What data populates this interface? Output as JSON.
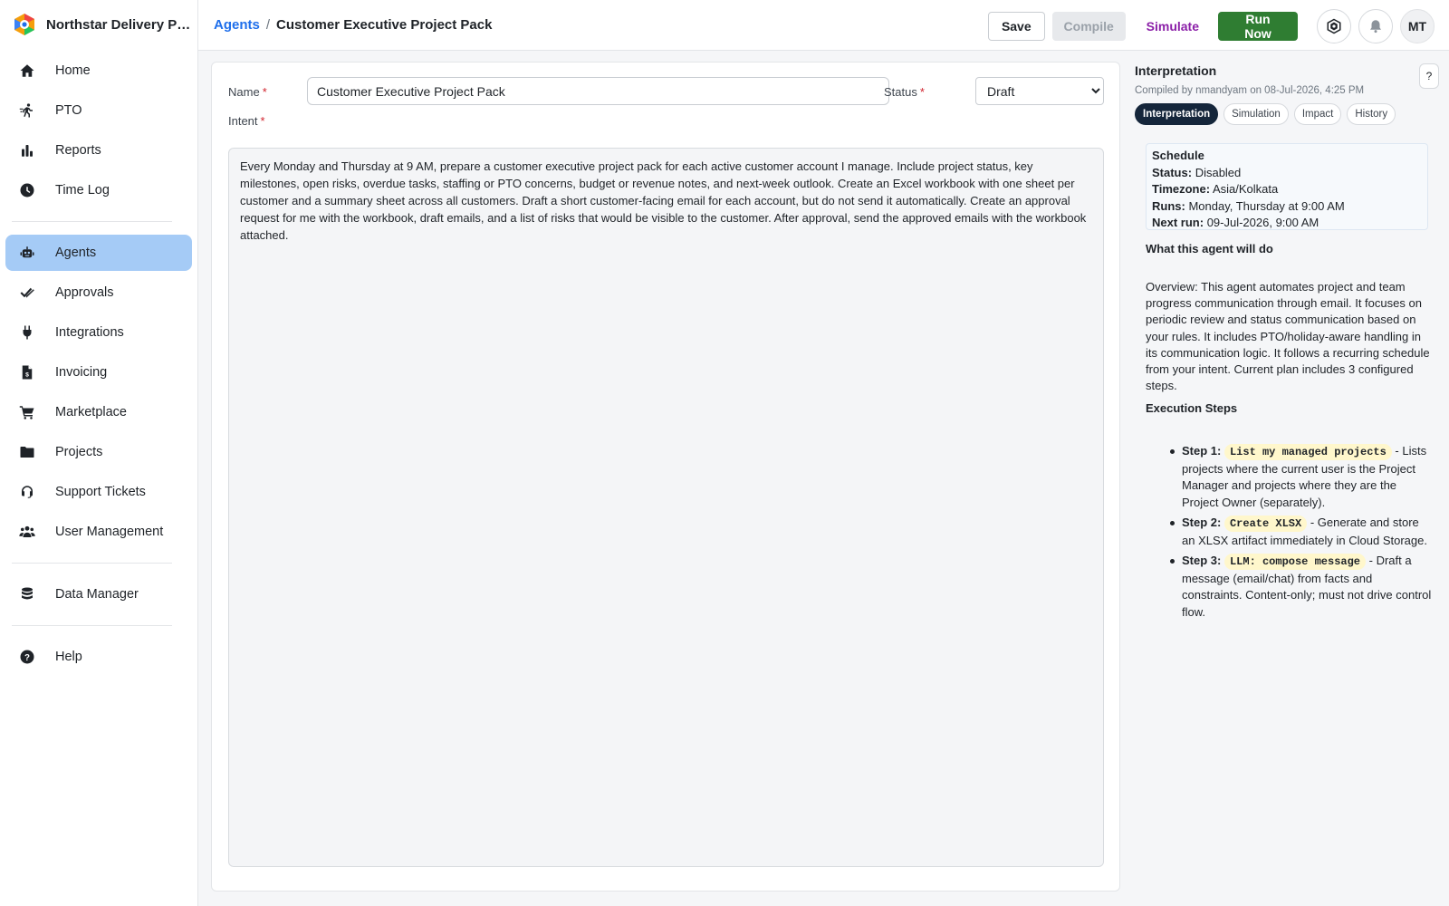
{
  "app": {
    "name": "Northstar Delivery Par...",
    "colors": {
      "accent": "#1f6feb",
      "active_nav": "#a5cbf6",
      "run": "#2f7d32",
      "simulate": "#8b1fa8"
    }
  },
  "sidebar": {
    "items": [
      {
        "label": "Home",
        "icon": "home-icon"
      },
      {
        "label": "PTO",
        "icon": "run-icon"
      },
      {
        "label": "Reports",
        "icon": "bar-chart-icon"
      },
      {
        "label": "Time Log",
        "icon": "clock-icon"
      },
      {
        "label": "Agents",
        "icon": "robot-icon",
        "active": true
      },
      {
        "label": "Approvals",
        "icon": "double-check-icon"
      },
      {
        "label": "Integrations",
        "icon": "plug-icon"
      },
      {
        "label": "Invoicing",
        "icon": "invoice-icon"
      },
      {
        "label": "Marketplace",
        "icon": "cart-icon"
      },
      {
        "label": "Projects",
        "icon": "folder-icon"
      },
      {
        "label": "Support Tickets",
        "icon": "headset-icon"
      },
      {
        "label": "User Management",
        "icon": "users-icon"
      },
      {
        "label": "Data Manager",
        "icon": "database-icon"
      },
      {
        "label": "Help",
        "icon": "help-circle-icon"
      }
    ]
  },
  "header": {
    "breadcrumb_parent": "Agents",
    "breadcrumb_sep": "/",
    "breadcrumb_current": "Customer Executive Project Pack",
    "save_label": "Save",
    "compile_label": "Compile",
    "simulate_label": "Simulate",
    "run_label": "Run Now",
    "avatar_initials": "MT"
  },
  "form": {
    "name_label": "Name",
    "name_value": "Customer Executive Project Pack",
    "status_label": "Status",
    "status_value": "Draft",
    "intent_label": "Intent",
    "required_mark": "*",
    "intent_value": "Every Monday and Thursday at 9 AM, prepare a customer executive project pack for each active customer account I manage. Include project status, key milestones, open risks, overdue tasks, staffing or PTO concerns, budget or revenue notes, and next-week outlook. Create an Excel workbook with one sheet per customer and a summary sheet across all customers. Draft a short customer-facing email for each account, but do not send it automatically. Create an approval request for me with the workbook, draft emails, and a list of risks that would be visible to the customer. After approval, send the approved emails with the workbook attached."
  },
  "panel": {
    "title": "Interpretation",
    "help_label": "?",
    "compiled_text": "Compiled by nmandyam on 08-Jul-2026, 4:25 PM",
    "tabs": [
      "Interpretation",
      "Simulation",
      "Impact",
      "History"
    ],
    "schedule": {
      "heading": "Schedule",
      "status_label": "Status:",
      "status_value": "Disabled",
      "timezone_label": "Timezone:",
      "timezone_value": "Asia/Kolkata",
      "runs_label": "Runs:",
      "runs_value": "Monday, Thursday at 9:00 AM",
      "next_label": "Next run:",
      "next_value": "09-Jul-2026, 9:00 AM"
    },
    "what_heading": "What this agent will do",
    "overview": "Overview: This agent automates project and team progress communication through email. It focuses on periodic review and status communication based on your rules. It includes PTO/holiday-aware handling in its communication logic. It follows a recurring schedule from your intent. Current plan includes 3 configured steps.",
    "steps_heading": "Execution Steps",
    "steps": [
      {
        "label": "Step 1:",
        "code": "List my managed projects",
        "desc": "- Lists projects where the current user is the Project Manager and projects where they are the Project Owner (separately)."
      },
      {
        "label": "Step 2:",
        "code": "Create XLSX",
        "desc": "- Generate and store an XLSX artifact immediately in Cloud Storage."
      },
      {
        "label": "Step 3:",
        "code": "LLM: compose message",
        "desc": "- Draft a message (email/chat) from facts and constraints. Content-only; must not drive control flow."
      }
    ]
  }
}
